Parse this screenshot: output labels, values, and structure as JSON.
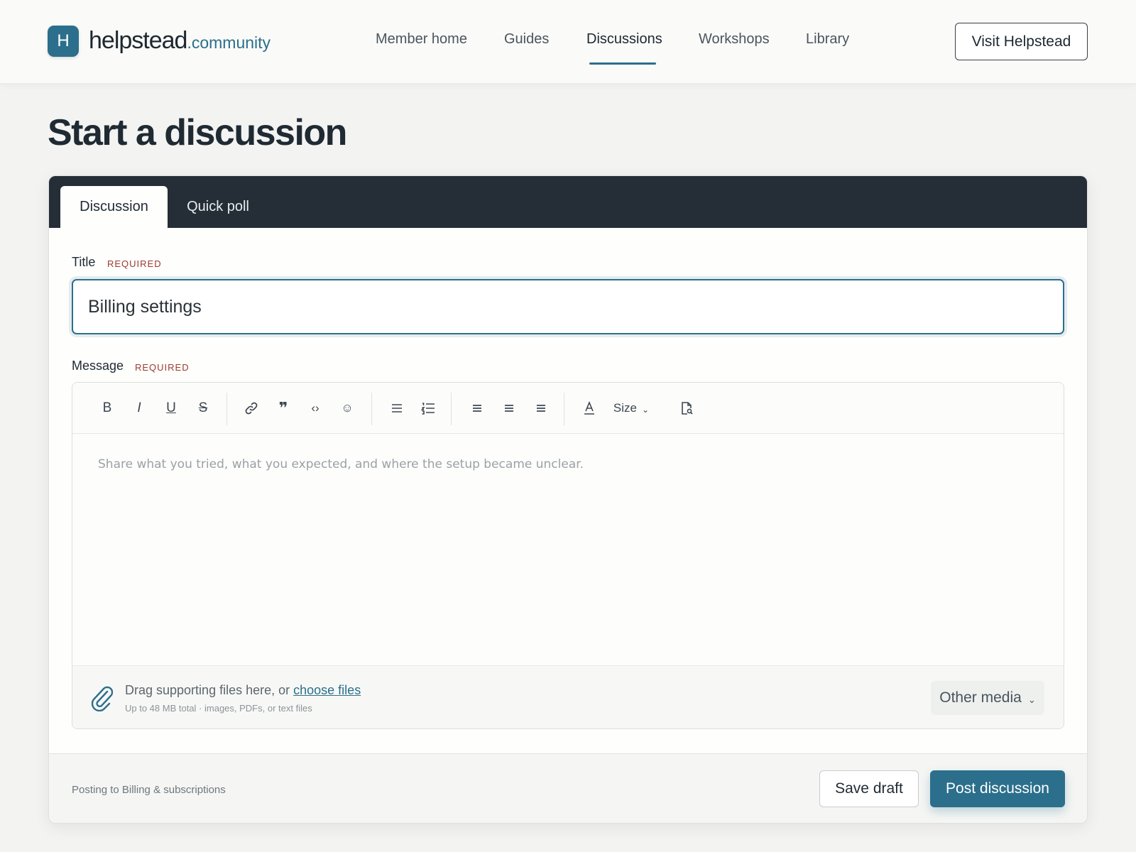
{
  "brand": {
    "mark": "H",
    "name": "helpstead",
    "suffix": ".community",
    "accent_color": "#2b6f8c"
  },
  "nav": {
    "items": [
      {
        "label": "Member home"
      },
      {
        "label": "Guides"
      },
      {
        "label": "Discussions",
        "active": true
      },
      {
        "label": "Workshops"
      },
      {
        "label": "Library"
      }
    ],
    "visit_label": "Visit Helpstead"
  },
  "page": {
    "title": "Start a discussion"
  },
  "tabs": [
    {
      "label": "Discussion",
      "active": true
    },
    {
      "label": "Quick poll",
      "active": false
    }
  ],
  "form": {
    "title_label": "Title",
    "title_required": "REQUIRED",
    "title_value": "Billing settings",
    "message_label": "Message",
    "message_required": "REQUIRED",
    "message_placeholder": "Share what you tried, what you expected, and where the setup became unclear."
  },
  "toolbar": {
    "bold": "B",
    "italic": "I",
    "underline": "U",
    "strike": "S",
    "size": "Size",
    "icons": [
      "link-icon",
      "quote-icon",
      "code-icon",
      "emoji-icon",
      "bullet-list-icon",
      "numbered-list-icon",
      "align-left-icon",
      "align-center-icon",
      "align-right-icon",
      "text-color-icon",
      "preview-document-icon"
    ]
  },
  "attachments": {
    "drag_text": "Drag supporting files here, or",
    "choose_link": "choose files",
    "limits": "Up to 48 MB total · images, PDFs, or text files",
    "other_media": "Other media"
  },
  "footer": {
    "posting_to": "Posting to Billing & subscriptions",
    "save_draft": "Save draft",
    "post": "Post discussion"
  }
}
